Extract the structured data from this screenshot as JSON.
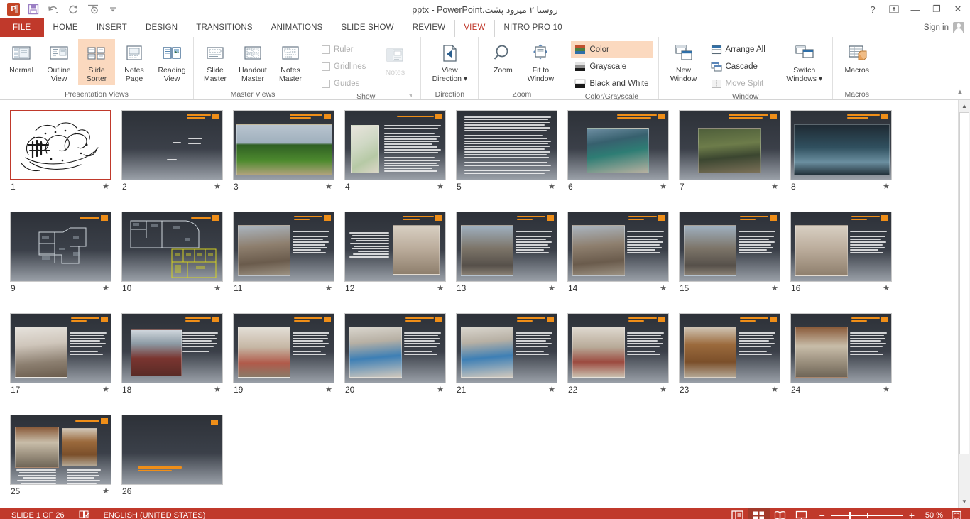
{
  "window": {
    "title": "روستا ۲ میرود پشت.pptx - PowerPoint",
    "help": "?",
    "ribbon_display": "ribbon-display-options",
    "minimize": "—",
    "restore": "❐",
    "close": "✕"
  },
  "quick_access": {
    "logo": "powerpoint-logo",
    "items": [
      {
        "name": "save-icon",
        "label": "Save"
      },
      {
        "name": "undo-icon",
        "label": "Undo"
      },
      {
        "name": "redo-icon",
        "label": "Repeat"
      },
      {
        "name": "start-slideshow-icon",
        "label": "Start From Beginning"
      },
      {
        "name": "customize-qat-icon",
        "label": "Customize Quick Access Toolbar"
      }
    ]
  },
  "tabs": [
    {
      "label": "FILE",
      "active": false,
      "file": true
    },
    {
      "label": "HOME",
      "active": false
    },
    {
      "label": "INSERT",
      "active": false
    },
    {
      "label": "DESIGN",
      "active": false
    },
    {
      "label": "TRANSITIONS",
      "active": false
    },
    {
      "label": "ANIMATIONS",
      "active": false
    },
    {
      "label": "SLIDE SHOW",
      "active": false
    },
    {
      "label": "REVIEW",
      "active": false
    },
    {
      "label": "VIEW",
      "active": true
    },
    {
      "label": "NITRO PRO 10",
      "active": false
    }
  ],
  "signin": {
    "label": "Sign in"
  },
  "ribbon": {
    "groups": [
      {
        "title": "Presentation Views",
        "buttons": [
          {
            "label": "Normal",
            "line2": "",
            "icon": "normal-view-icon",
            "selected": false
          },
          {
            "label": "Outline",
            "line2": "View",
            "icon": "outline-view-icon",
            "selected": false
          },
          {
            "label": "Slide",
            "line2": "Sorter",
            "icon": "slide-sorter-icon",
            "selected": true
          },
          {
            "label": "Notes",
            "line2": "Page",
            "icon": "notes-page-icon",
            "selected": false
          },
          {
            "label": "Reading",
            "line2": "View",
            "icon": "reading-view-icon",
            "selected": false
          }
        ]
      },
      {
        "title": "Master Views",
        "buttons": [
          {
            "label": "Slide",
            "line2": "Master",
            "icon": "slide-master-icon",
            "selected": false
          },
          {
            "label": "Handout",
            "line2": "Master",
            "icon": "handout-master-icon",
            "selected": false
          },
          {
            "label": "Notes",
            "line2": "Master",
            "icon": "notes-master-icon",
            "selected": false
          }
        ]
      },
      {
        "title": "Show",
        "has_launcher": true,
        "checks": [
          {
            "label": "Ruler",
            "checked": false,
            "disabled": true
          },
          {
            "label": "Gridlines",
            "checked": false,
            "disabled": true
          },
          {
            "label": "Guides",
            "checked": false,
            "disabled": true
          }
        ],
        "buttons": [
          {
            "label": "Notes",
            "line2": "",
            "icon": "notes-icon",
            "disabled": true
          }
        ]
      },
      {
        "title": "Direction",
        "buttons": [
          {
            "label": "View",
            "line2": "Direction ▾",
            "icon": "view-direction-icon",
            "selected": false
          }
        ]
      },
      {
        "title": "Zoom",
        "buttons": [
          {
            "label": "Zoom",
            "line2": "",
            "icon": "zoom-icon",
            "selected": false
          },
          {
            "label": "Fit to",
            "line2": "Window",
            "icon": "fit-to-window-icon",
            "selected": false
          }
        ]
      },
      {
        "title": "Color/Grayscale",
        "checks": [
          {
            "label": "Color",
            "icon": "color-swatch-icon",
            "selected": true
          },
          {
            "label": "Grayscale",
            "icon": "grayscale-swatch-icon",
            "selected": false
          },
          {
            "label": "Black and White",
            "icon": "bw-swatch-icon",
            "selected": false
          }
        ]
      },
      {
        "title": "Window",
        "buttons": [
          {
            "label": "New",
            "line2": "Window",
            "icon": "new-window-icon",
            "selected": false
          }
        ],
        "checks": [
          {
            "label": "Arrange All",
            "icon": "arrange-all-icon",
            "disabled": false
          },
          {
            "label": "Cascade",
            "icon": "cascade-icon",
            "disabled": false
          },
          {
            "label": "Move Split",
            "icon": "move-split-icon",
            "disabled": true
          }
        ],
        "buttons2": [
          {
            "label": "Switch",
            "line2": "Windows ▾",
            "icon": "switch-windows-icon",
            "selected": false
          }
        ]
      },
      {
        "title": "Macros",
        "buttons": [
          {
            "label": "Macros",
            "line2": "",
            "icon": "macros-icon",
            "selected": false
          }
        ]
      }
    ],
    "collapse": "collapse-ribbon-icon"
  },
  "slides": [
    {
      "number": "1",
      "star": true,
      "kind": "calligraphy",
      "selected": true
    },
    {
      "number": "2",
      "star": true,
      "kind": "title-sparse"
    },
    {
      "number": "3",
      "star": true,
      "kind": "photo-full",
      "photo": "ph-field"
    },
    {
      "number": "4",
      "star": true,
      "kind": "map-text",
      "photo": "ph-map"
    },
    {
      "number": "5",
      "star": true,
      "kind": "text-only"
    },
    {
      "number": "6",
      "star": true,
      "kind": "photo-center",
      "photo": "ph-shop"
    },
    {
      "number": "7",
      "star": true,
      "kind": "photo-center",
      "photo": "ph-bridge"
    },
    {
      "number": "8",
      "star": true,
      "kind": "photo-full",
      "photo": "ph-night"
    },
    {
      "number": "9",
      "star": true,
      "kind": "floorplan"
    },
    {
      "number": "10",
      "star": true,
      "kind": "floorplan2"
    },
    {
      "number": "11",
      "star": true,
      "kind": "photo-left-text",
      "photo": "ph-house"
    },
    {
      "number": "12",
      "star": true,
      "kind": "photo-right-text",
      "photo": "ph-wall"
    },
    {
      "number": "13",
      "star": true,
      "kind": "photo-left-text",
      "photo": "ph-alley"
    },
    {
      "number": "14",
      "star": true,
      "kind": "photo-left-text",
      "photo": "ph-house"
    },
    {
      "number": "15",
      "star": true,
      "kind": "photo-left-text",
      "photo": "ph-alley"
    },
    {
      "number": "16",
      "star": true,
      "kind": "photo-left-text",
      "photo": "ph-wall"
    },
    {
      "number": "17",
      "star": true,
      "kind": "photo-left-text",
      "photo": "ph-room"
    },
    {
      "number": "18",
      "star": true,
      "kind": "photo-center-text",
      "photo": "ph-window"
    },
    {
      "number": "19",
      "star": true,
      "kind": "photo-left-text",
      "photo": "ph-curtain"
    },
    {
      "number": "20",
      "star": true,
      "kind": "photo-left-text",
      "photo": "ph-bed"
    },
    {
      "number": "21",
      "star": true,
      "kind": "photo-left-text",
      "photo": "ph-bed"
    },
    {
      "number": "22",
      "star": true,
      "kind": "photo-left-text",
      "photo": "ph-carpet"
    },
    {
      "number": "23",
      "star": true,
      "kind": "photo-left-text",
      "photo": "ph-door"
    },
    {
      "number": "24",
      "star": true,
      "kind": "photo-left-text",
      "photo": "ph-porch"
    },
    {
      "number": "25",
      "star": true,
      "kind": "two-photo"
    },
    {
      "number": "26",
      "star": false,
      "kind": "end-slide"
    }
  ],
  "status": {
    "slide_counter": "SLIDE 1 OF 26",
    "language": "ENGLISH (UNITED STATES)",
    "notes_icon": "spelling-icon",
    "views": [
      {
        "name": "normal-view-button",
        "active": false
      },
      {
        "name": "slide-sorter-view-button",
        "active": true
      },
      {
        "name": "reading-view-button",
        "active": false
      },
      {
        "name": "slideshow-view-button",
        "active": false
      }
    ],
    "zoom_out": "−",
    "zoom_in": "+",
    "zoom_level": "50 %",
    "fit_slide": "fit-slide-to-window-icon"
  },
  "colors": {
    "accent_red": "#c0392b",
    "highlight_orange": "#fbd9bf",
    "slide_orange": "#ef8e18",
    "slide_bg_dark": "#2d3138"
  }
}
